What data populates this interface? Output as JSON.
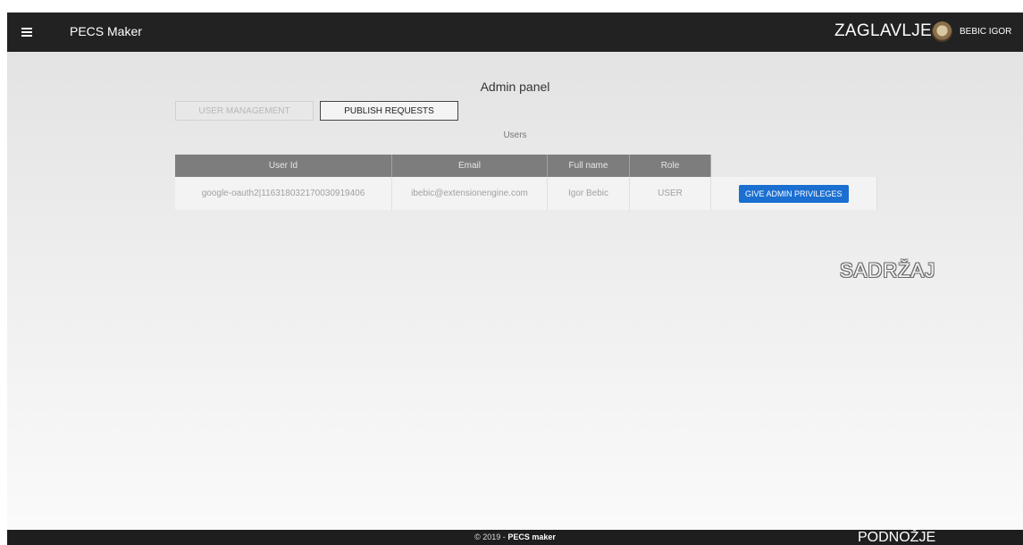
{
  "header": {
    "app_title": "PECS Maker",
    "label": "ZAGLAVLJE",
    "username": "BEBIC IGOR"
  },
  "main": {
    "title": "Admin panel",
    "tabs": [
      {
        "label": "USER MANAGEMENT",
        "active": false
      },
      {
        "label": "PUBLISH REQUESTS",
        "active": true
      }
    ],
    "table_caption": "Users",
    "columns": [
      "User Id",
      "Email",
      "Full name",
      "Role"
    ],
    "rows": [
      {
        "user_id": "google-oauth2|116318032170030919406",
        "email": "ibebic@extensionengine.com",
        "full_name": "Igor Bebic",
        "role": "USER",
        "action": "GIVE ADMIN PRIVILEGES"
      }
    ],
    "content_label": "SADRŽAJ"
  },
  "footer": {
    "copyright_prefix": "© 2019 - ",
    "copyright_brand": "PECS maker",
    "label": "PODNOŽJE"
  },
  "colors": {
    "topbar": "#222222",
    "table_header": "#7d7d7d",
    "action_button": "#1a6fd1"
  },
  "icons": {
    "menu": "hamburger-menu-icon",
    "avatar": "user-avatar"
  }
}
